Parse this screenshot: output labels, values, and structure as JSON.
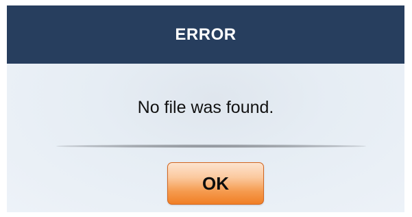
{
  "dialog": {
    "title": "ERROR",
    "message": "No file was found.",
    "ok_label": "OK"
  },
  "colors": {
    "title_bar": "#273e5e",
    "title_text": "#ffffff",
    "body_background": "#e8eef5",
    "button_top": "#fde4cf",
    "button_bottom": "#f07f26",
    "button_border": "#d2651e"
  }
}
